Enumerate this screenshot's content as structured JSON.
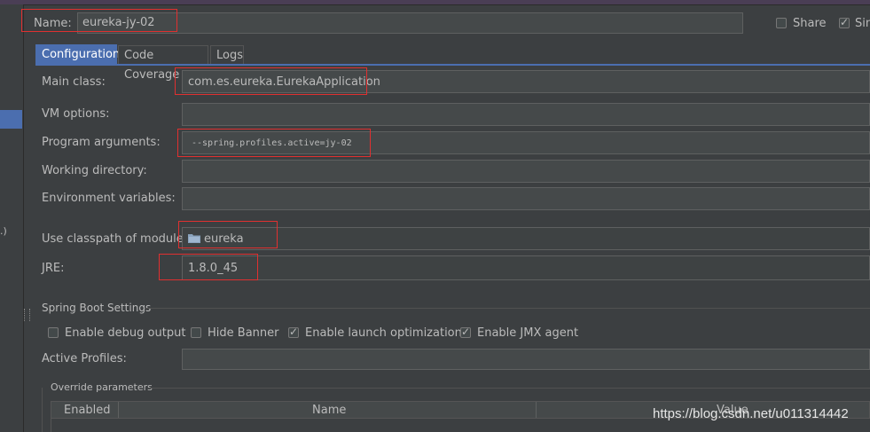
{
  "name_field": {
    "label": "Name:",
    "value": "eureka-jy-02"
  },
  "share_label": "Share",
  "single_label": "Sin",
  "tabs": [
    {
      "label": "Configuration"
    },
    {
      "label": "Code Coverage"
    },
    {
      "label": "Logs"
    }
  ],
  "left_panel_text": ".)",
  "form": {
    "main_class": {
      "label": "Main class:",
      "value": "com.es.eureka.EurekaApplication"
    },
    "vm_options": {
      "label": "VM options:",
      "value": ""
    },
    "program_args": {
      "label": "Program arguments:",
      "value": "--spring.profiles.active=jy-02"
    },
    "working_dir": {
      "label": "Working directory:",
      "value": ""
    },
    "env_vars": {
      "label": "Environment variables:",
      "value": ""
    },
    "classpath": {
      "label": "Use classpath of module:",
      "value": "eureka"
    },
    "jre": {
      "label": "JRE:",
      "value": "1.8.0_45"
    }
  },
  "spring_boot": {
    "section_title": "Spring Boot Settings",
    "enable_debug": {
      "label": "Enable debug output",
      "checked": false
    },
    "hide_banner": {
      "label": "Hide Banner",
      "checked": false
    },
    "launch_opt": {
      "label": "Enable launch optimization",
      "checked": true
    },
    "jmx_agent": {
      "label": "Enable JMX agent",
      "checked": true
    },
    "active_profiles": {
      "label": "Active Profiles:",
      "value": ""
    }
  },
  "override": {
    "title": "Override parameters",
    "columns": [
      "Enabled",
      "Name",
      "Value"
    ]
  },
  "watermark": "https://blog.csdn.net/u011314442",
  "colors": {
    "accent": "#4b6eaf",
    "highlight_box": "#e03030",
    "background": "#3c3f41"
  }
}
